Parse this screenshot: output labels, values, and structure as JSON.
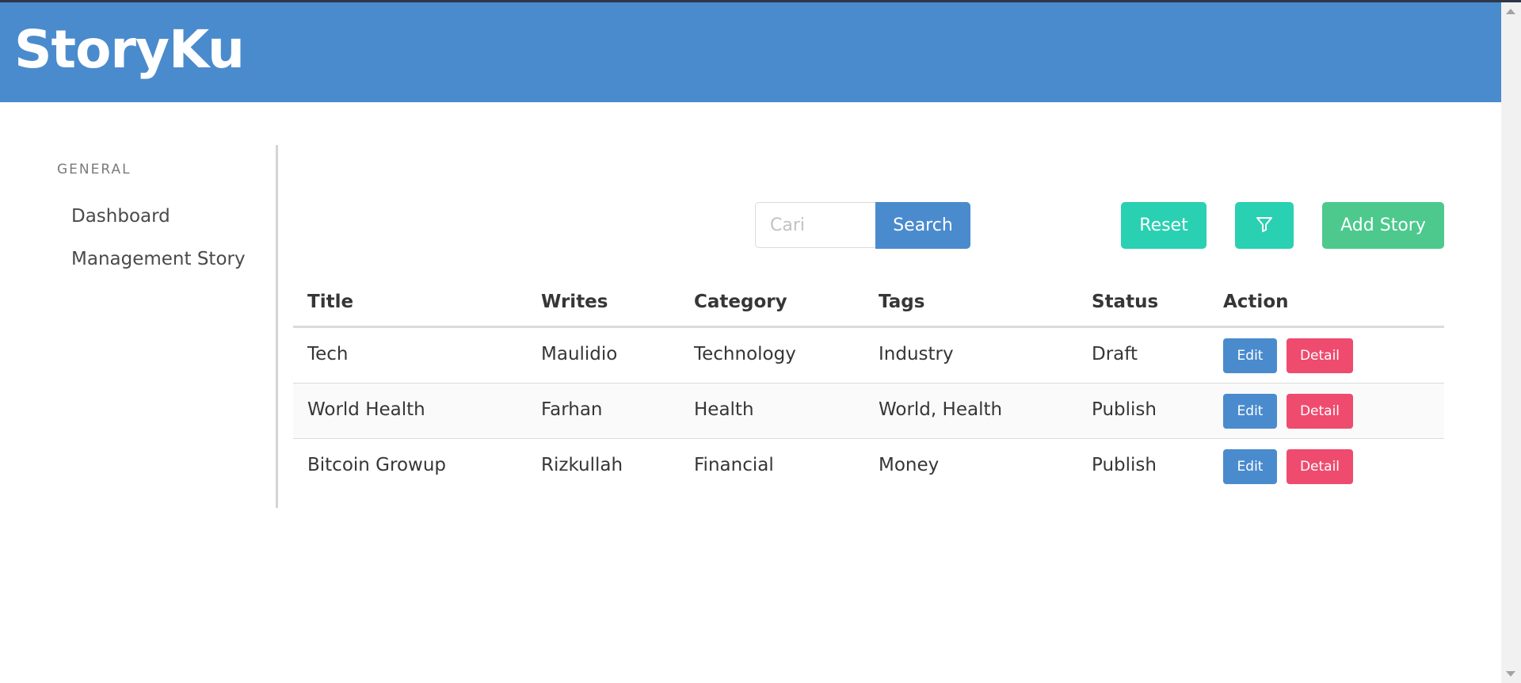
{
  "header": {
    "brand": "StoryKu"
  },
  "sidebar": {
    "section_label": "General",
    "items": [
      {
        "label": "Dashboard"
      },
      {
        "label": "Management Story"
      }
    ]
  },
  "toolbar": {
    "search_placeholder": "Cari",
    "search_value": "",
    "search_label": "Search",
    "reset_label": "Reset",
    "filter_icon": "filter-icon",
    "add_label": "Add Story"
  },
  "table": {
    "headers": [
      "Title",
      "Writes",
      "Category",
      "Tags",
      "Status",
      "Action"
    ],
    "rows": [
      {
        "title": "Tech",
        "writes": "Maulidio",
        "category": "Technology",
        "tags": "Industry",
        "status": "Draft",
        "edit": "Edit",
        "detail": "Detail"
      },
      {
        "title": "World Health",
        "writes": "Farhan",
        "category": "Health",
        "tags": "World, Health",
        "status": "Publish",
        "edit": "Edit",
        "detail": "Detail"
      },
      {
        "title": "Bitcoin Growup",
        "writes": "Rizkullah",
        "category": "Financial",
        "tags": "Money",
        "status": "Publish",
        "edit": "Edit",
        "detail": "Detail"
      }
    ]
  },
  "colors": {
    "navbar": "#4a8bcd",
    "primary": "#4a8bcd",
    "teal": "#29d0b1",
    "green": "#4dc98d",
    "danger": "#ee4b6f"
  }
}
